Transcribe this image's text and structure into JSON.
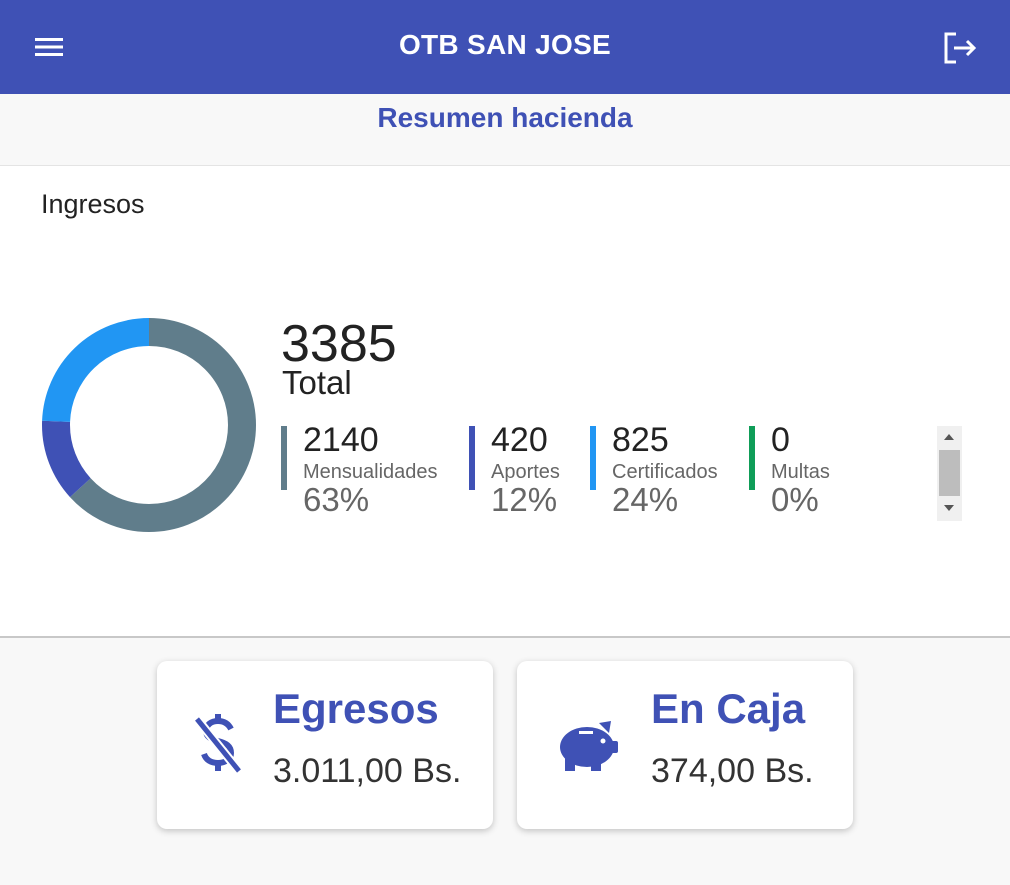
{
  "appbar": {
    "title": "OTB SAN JOSE",
    "menu_icon": "menu-icon",
    "logout_icon": "logout-icon"
  },
  "subheader": {
    "title": "Resumen hacienda"
  },
  "ingresos": {
    "title": "Ingresos",
    "total_value": "3385",
    "total_label": "Total",
    "items": [
      {
        "value": "2140",
        "label": "Mensualidades",
        "percent": "63%",
        "fraction": 0.632,
        "color": "#607d8b"
      },
      {
        "value": "420",
        "label": "Aportes",
        "percent": "12%",
        "fraction": 0.124,
        "color": "#3f51b5"
      },
      {
        "value": "825",
        "label": "Certificados",
        "percent": "24%",
        "fraction": 0.244,
        "color": "#2196f3"
      },
      {
        "value": "0",
        "label": "Multas",
        "percent": "0%",
        "fraction": 0,
        "color": "#0f9d58"
      }
    ]
  },
  "egresos": {
    "title": "Egresos",
    "value": "3.011,00 Bs.",
    "icon": "money-off-icon"
  },
  "caja": {
    "title": "En Caja",
    "value": "374,00 Bs.",
    "icon": "piggy-bank-icon"
  },
  "colors": {
    "primary": "#3f51b5",
    "background": "#f8f8f8"
  }
}
